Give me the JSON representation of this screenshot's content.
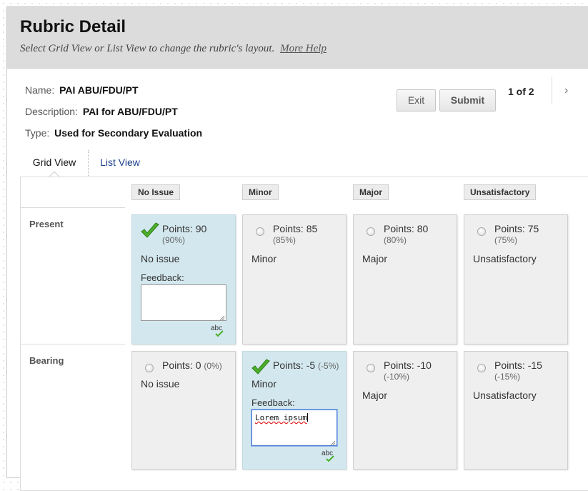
{
  "header": {
    "title": "Rubric Detail",
    "subtitle": "Select Grid View or List View to change the rubric's layout.",
    "help_link": "More Help"
  },
  "meta": {
    "name_label": "Name:",
    "name_value": "PAI ABU/FDU/PT",
    "description_label": "Description:",
    "description_value": "PAI for ABU/FDU/PT",
    "type_label": "Type:",
    "type_value": "Used for Secondary Evaluation"
  },
  "actions": {
    "exit": "Exit",
    "submit": "Submit",
    "page_counter": "1 of 2",
    "next_icon": "›"
  },
  "tabs": {
    "grid": "Grid View",
    "list": "List View"
  },
  "columns": [
    "No Issue",
    "Minor",
    "Major",
    "Unsatisfactory"
  ],
  "rows": [
    {
      "label": "Present",
      "cells": [
        {
          "points": "Points: 90",
          "pct": "(90%)",
          "desc": "No issue",
          "selected": true,
          "feedback_label": "Feedback:",
          "feedback_value": ""
        },
        {
          "points": "Points: 85",
          "pct": "(85%)",
          "desc": "Minor",
          "selected": false
        },
        {
          "points": "Points: 80",
          "pct": "(80%)",
          "desc": "Major",
          "selected": false
        },
        {
          "points": "Points: 75",
          "pct": "(75%)",
          "desc": "Unsatisfactory",
          "selected": false
        }
      ]
    },
    {
      "label": "Bearing",
      "cells": [
        {
          "points": "Points: 0",
          "pct": "(0%)",
          "desc": "No issue",
          "selected": false
        },
        {
          "points": "Points: -5",
          "pct": "(-5%)",
          "desc": "Minor",
          "selected": true,
          "feedback_label": "Feedback:",
          "feedback_value": "Lorem ipsum"
        },
        {
          "points": "Points: -10",
          "pct": "(-10%)",
          "desc": "Major",
          "selected": false
        },
        {
          "points": "Points: -15",
          "pct": "(-15%)",
          "desc": "Unsatisfactory",
          "selected": false
        }
      ]
    }
  ],
  "spellcheck_label": "abc",
  "colors": {
    "selected_cell": "#d3e8ee",
    "check_green": "#4caf2a",
    "link_blue": "#1d3f8a"
  },
  "icons": {
    "selected": "green-check-icon",
    "unselected": "radio-icon",
    "next": "chevron-right-icon",
    "spellcheck": "spellcheck-icon"
  }
}
